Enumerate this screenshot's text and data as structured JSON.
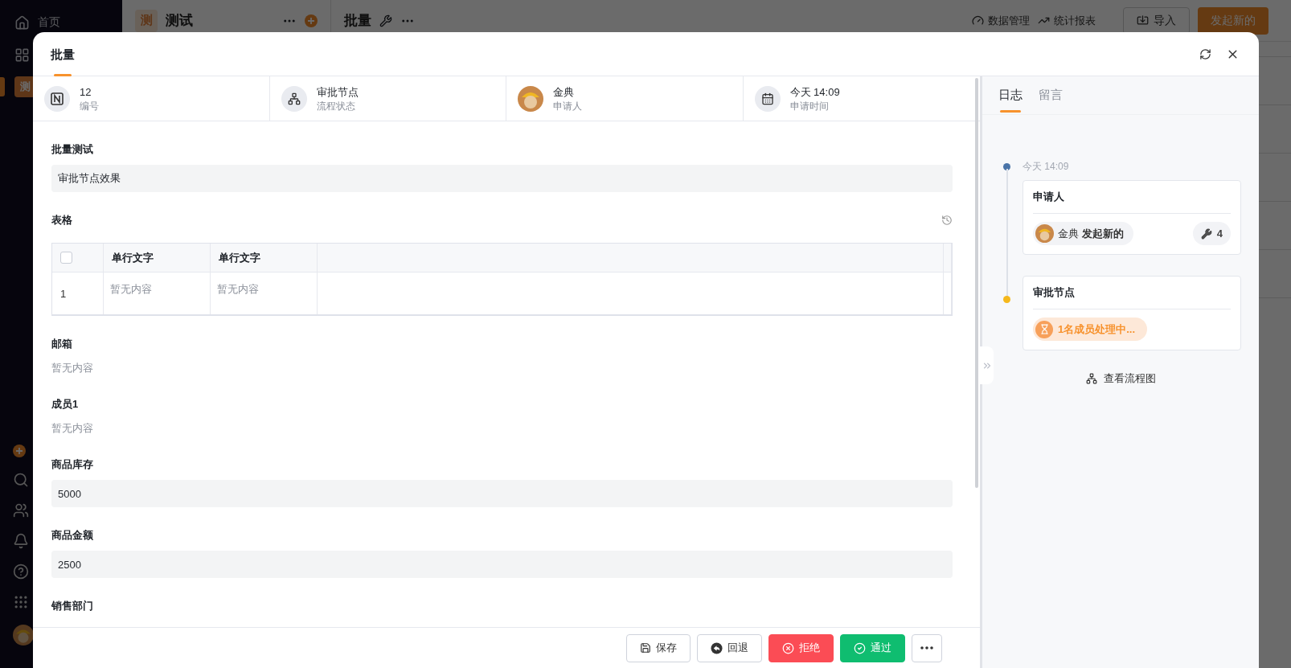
{
  "sidebar": {
    "items": [
      {
        "kind": "home",
        "label": "首页",
        "selected": false
      },
      {
        "kind": "apps",
        "selected": false
      },
      {
        "kind": "app",
        "label": "测",
        "selected": true
      }
    ]
  },
  "app_panel": {
    "badge": "测",
    "title": "测试"
  },
  "page_header": {
    "title": "批量",
    "actions": [
      {
        "kind": "data",
        "label": "数据管理"
      },
      {
        "kind": "report",
        "label": "统计报表"
      }
    ],
    "import_button": "导入",
    "create_button": "发起新的"
  },
  "modal": {
    "title": "批量",
    "info": [
      {
        "kind": "number",
        "value": "12",
        "label": "编号"
      },
      {
        "kind": "status",
        "value": "审批节点",
        "label": "流程状态"
      },
      {
        "kind": "person",
        "value": "金典",
        "label": "申请人"
      },
      {
        "kind": "time",
        "value": "今天 14:09",
        "label": "申请时间"
      }
    ],
    "fields": [
      {
        "kind": "input",
        "label": "批量测试",
        "value": "审批节点效果"
      },
      {
        "kind": "table",
        "label": "表格",
        "table": {
          "select_all": {
            "checked": false
          },
          "columns": [
            "单行文字",
            "单行文字"
          ],
          "rows": [
            {
              "index": "1",
              "cells": [
                "暂无内容",
                "暂无内容"
              ]
            }
          ]
        }
      },
      {
        "kind": "text",
        "label": "邮箱",
        "value": "暂无内容"
      },
      {
        "kind": "text",
        "label": "成员1",
        "value": "暂无内容"
      },
      {
        "kind": "input",
        "label": "商品库存",
        "value": "5000"
      },
      {
        "kind": "input",
        "label": "商品金额",
        "value": "2500"
      },
      {
        "kind": "text",
        "label": "销售部门"
      }
    ],
    "footer_buttons": [
      {
        "kind": "save",
        "label": "保存"
      },
      {
        "kind": "back",
        "label": "回退"
      },
      {
        "kind": "reject",
        "label": "拒绝"
      },
      {
        "kind": "approve",
        "label": "通过"
      },
      {
        "kind": "more"
      }
    ]
  },
  "log_panel": {
    "tabs": [
      {
        "label": "日志",
        "selected": true
      },
      {
        "label": "留言",
        "selected": false
      }
    ],
    "timeline": [
      {
        "kind": "applicant",
        "time": "今天 14:09",
        "color": "#4a74a8",
        "title": "申请人",
        "person": "金典",
        "action": "发起新的",
        "count": "4"
      },
      {
        "kind": "pending",
        "color": "#f5b81c",
        "title": "审批节点",
        "status": "1名成员处理中..."
      }
    ],
    "flow_link": "查看流程图"
  }
}
